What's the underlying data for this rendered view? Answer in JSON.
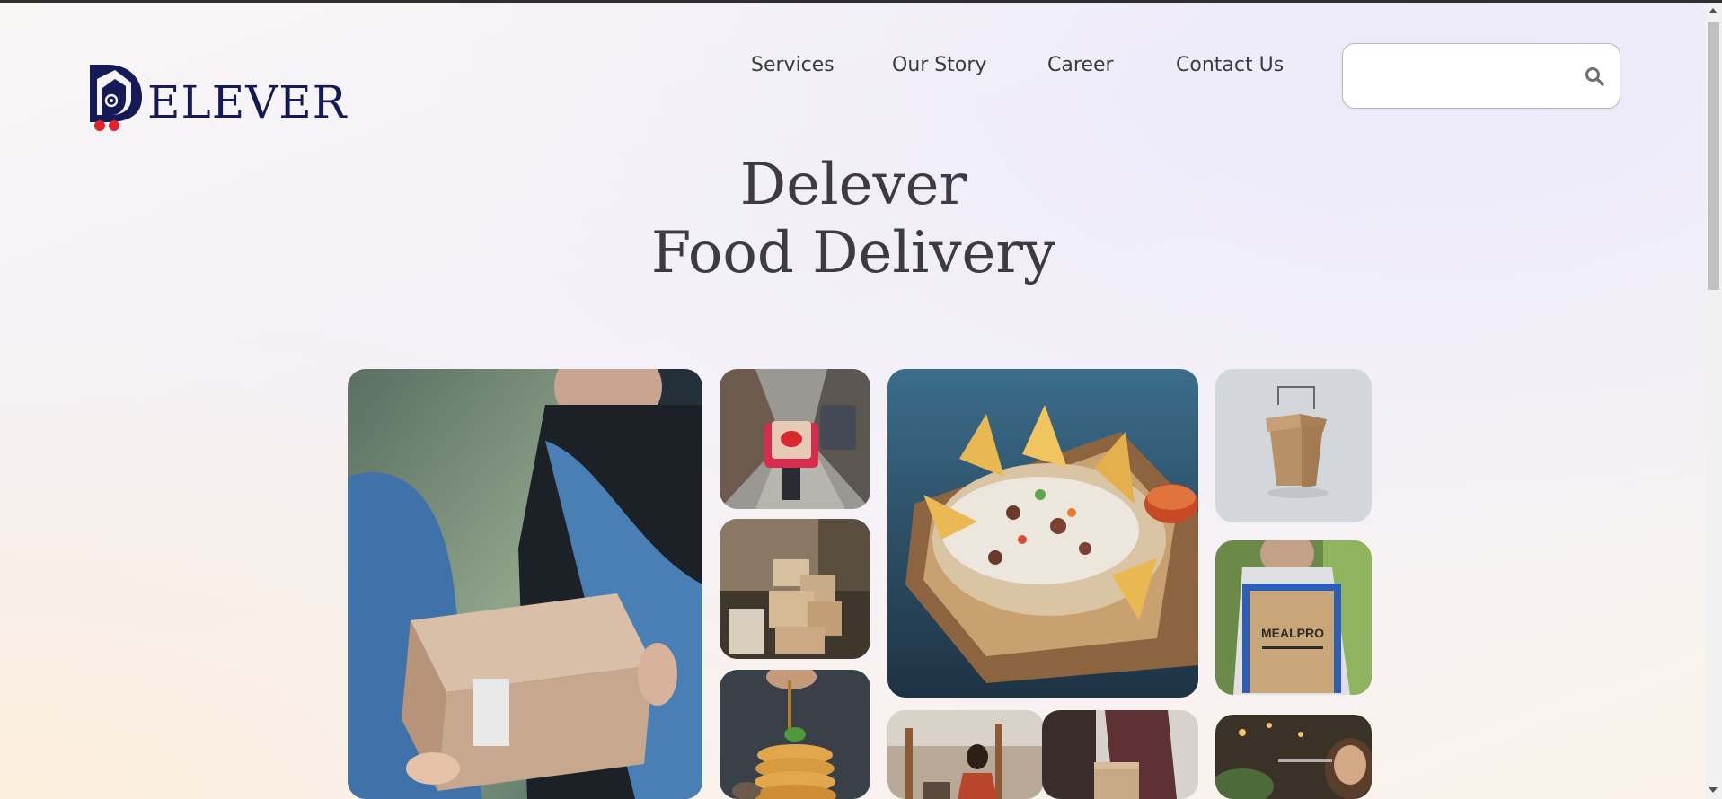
{
  "brand": {
    "name": "ELEVER",
    "logo_letter": "D",
    "color": "#141a55",
    "accent": "#e0232c"
  },
  "nav": {
    "items": [
      {
        "label": "Services"
      },
      {
        "label": "Our Story"
      },
      {
        "label": "Career"
      },
      {
        "label": "Contact Us"
      }
    ]
  },
  "search": {
    "placeholder": "",
    "icon": "search-icon"
  },
  "hero": {
    "line1": "Delever",
    "line2": "Food Delivery"
  },
  "gallery": {
    "tiles": [
      {
        "name": "photo-package-handoff"
      },
      {
        "name": "photo-delivery-cyclist"
      },
      {
        "name": "photo-stacked-boxes"
      },
      {
        "name": "photo-pancakes"
      },
      {
        "name": "photo-nachos-tray"
      },
      {
        "name": "photo-office-worker"
      },
      {
        "name": "photo-box-delivery"
      },
      {
        "name": "photo-takeout-box"
      },
      {
        "name": "photo-mealpro-box",
        "label": "MEALPRO"
      },
      {
        "name": "photo-dining-woman"
      }
    ]
  }
}
